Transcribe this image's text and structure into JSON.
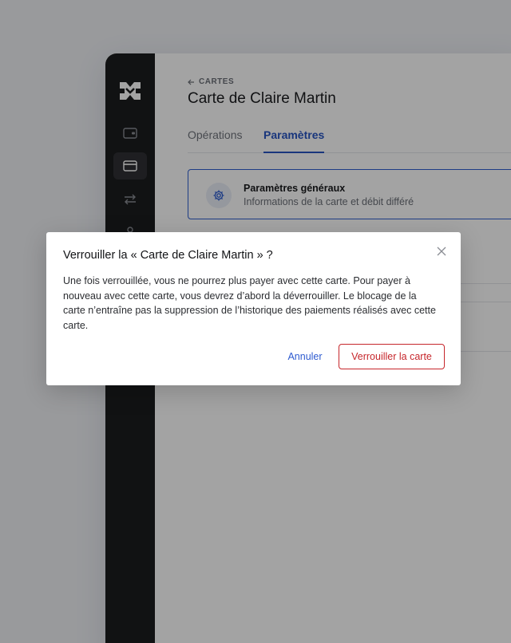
{
  "breadcrumb": {
    "label": "CARTES",
    "icon": "arrow-left-icon"
  },
  "page": {
    "title": "Carte de Claire Martin"
  },
  "tabs": [
    {
      "label": "Opérations",
      "active": false
    },
    {
      "label": "Paramètres",
      "active": true
    }
  ],
  "settings": {
    "general": {
      "title": "Paramètres généraux",
      "subtitle": "Informations de la carte et débit différé",
      "icon": "gear-icon"
    }
  },
  "sidebar": {
    "items": [
      {
        "icon": "wallet-icon",
        "active": false
      },
      {
        "icon": "credit-card-icon",
        "active": true
      },
      {
        "icon": "transfer-arrows-icon",
        "active": false
      },
      {
        "icon": "user-icon",
        "active": false
      }
    ]
  },
  "modal": {
    "title": "Verrouiller la « Carte de Claire Martin » ?",
    "body": "Une fois verrouillée, vous ne pourrez plus payer avec cette carte. Pour payer à nouveau avec cette carte, vous devrez d’abord la déverrouiller. Le blocage de la carte n’entraîne pas la suppression de l’historique des paiements réalisés avec cette carte.",
    "cancel_label": "Annuler",
    "confirm_label": "Verrouiller la carte"
  },
  "colors": {
    "accent": "#2855c3",
    "danger": "#c6262b",
    "sidebar": "#1c1d1f"
  }
}
